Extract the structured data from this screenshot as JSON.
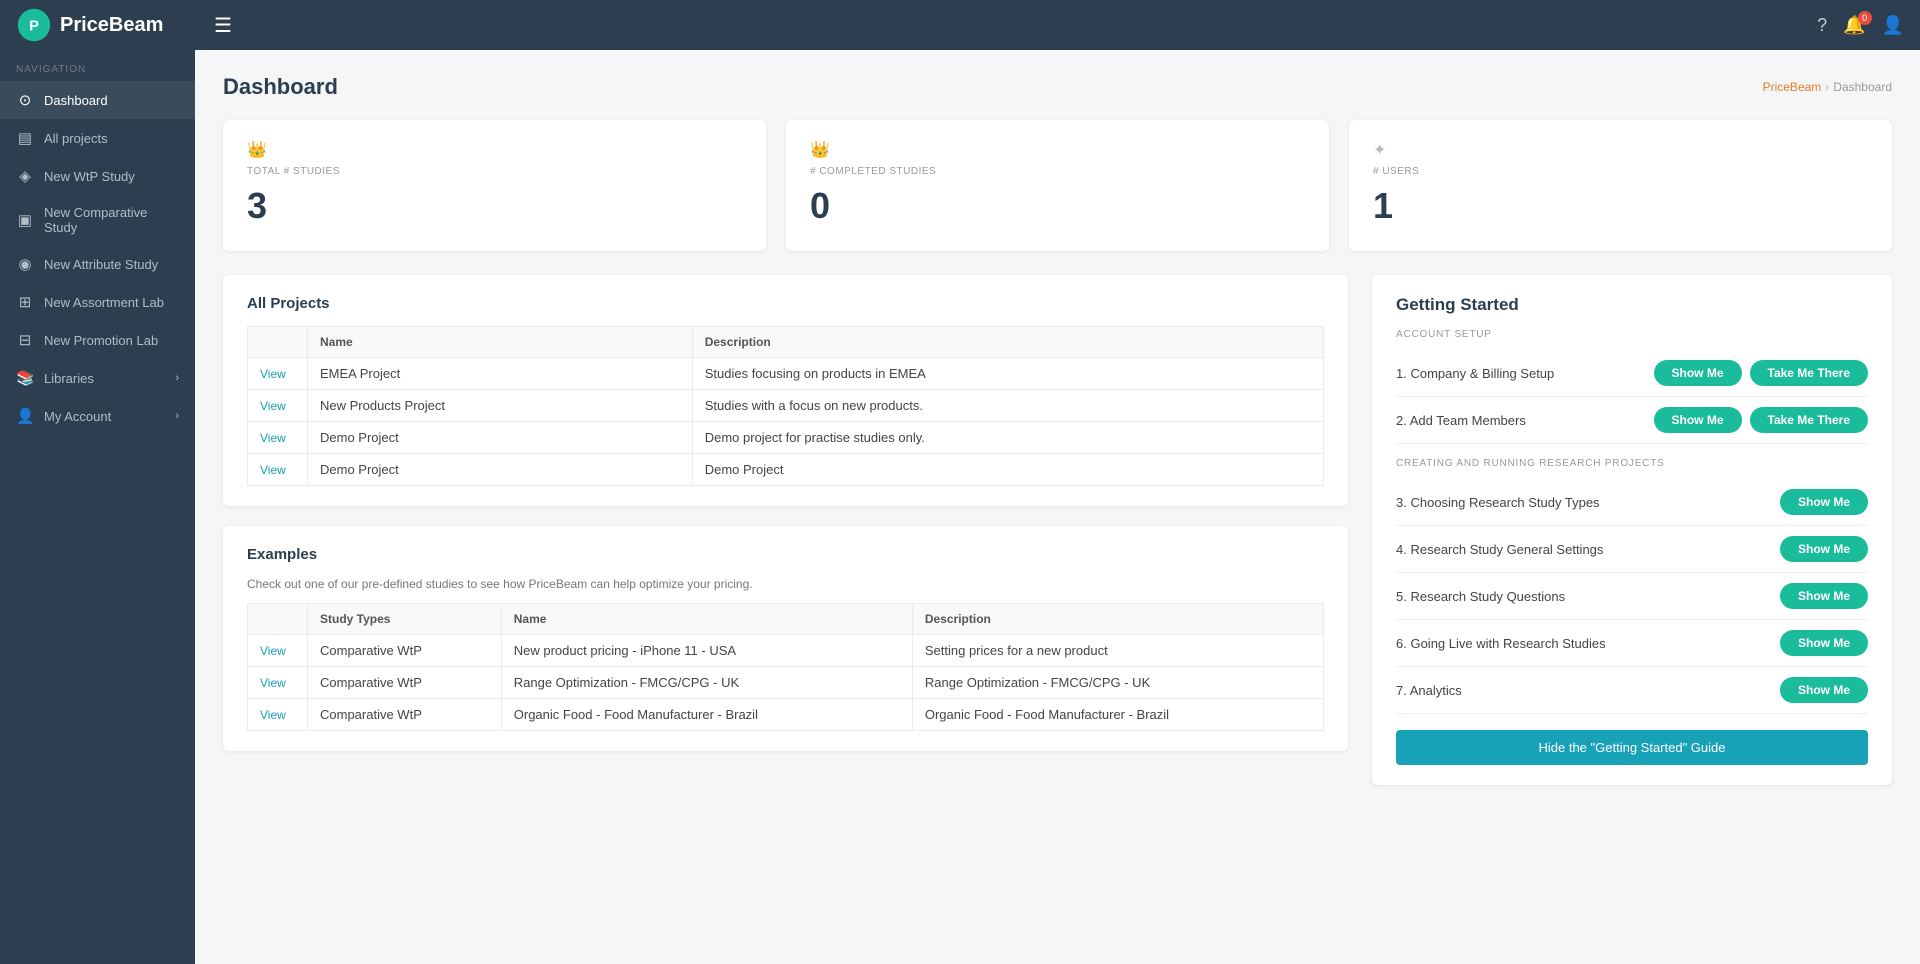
{
  "topbar": {
    "logo_text": "PriceBeam",
    "menu_icon": "☰",
    "notification_count": "0",
    "icons": {
      "help": "?",
      "bell": "🔔",
      "user": "👤"
    }
  },
  "sidebar": {
    "nav_label": "NAVIGATION",
    "items": [
      {
        "id": "dashboard",
        "label": "Dashboard",
        "icon": "⊙",
        "active": true
      },
      {
        "id": "all-projects",
        "label": "All projects",
        "icon": "▤",
        "active": false
      },
      {
        "id": "new-wtp-study",
        "label": "New WtP Study",
        "icon": "◈",
        "active": false
      },
      {
        "id": "new-comparative-study",
        "label": "New Comparative Study",
        "icon": "▣",
        "active": false
      },
      {
        "id": "new-attribute-study",
        "label": "New Attribute Study",
        "icon": "◉",
        "active": false
      },
      {
        "id": "new-assortment-lab",
        "label": "New Assortment Lab",
        "icon": "⊞",
        "active": false
      },
      {
        "id": "new-promotion-lab",
        "label": "New Promotion Lab",
        "icon": "⊟",
        "active": false
      },
      {
        "id": "libraries",
        "label": "Libraries",
        "icon": "📚",
        "has_arrow": true,
        "active": false
      },
      {
        "id": "my-account",
        "label": "My Account",
        "icon": "👤",
        "has_arrow": true,
        "active": false
      }
    ]
  },
  "page": {
    "title": "Dashboard",
    "breadcrumb_home": "PriceBeam",
    "breadcrumb_current": "Dashboard"
  },
  "stats": [
    {
      "icon": "👑",
      "label": "TOTAL # STUDIES",
      "value": "3"
    },
    {
      "icon": "👑",
      "label": "# COMPLETED STUDIES",
      "value": "0"
    },
    {
      "icon": "✦",
      "label": "# USERS",
      "value": "1"
    }
  ],
  "all_projects": {
    "section_title": "All Projects",
    "columns": [
      "",
      "Name",
      "Description"
    ],
    "rows": [
      {
        "view": "View",
        "name": "EMEA Project",
        "description": "Studies focusing on products in EMEA"
      },
      {
        "view": "View",
        "name": "New Products Project",
        "description": "Studies with a focus on new products."
      },
      {
        "view": "View",
        "name": "Demo Project",
        "description": "Demo project for practise studies only."
      },
      {
        "view": "View",
        "name": "Demo Project",
        "description": "Demo Project"
      }
    ]
  },
  "examples": {
    "section_title": "Examples",
    "note": "Check out one of our pre-defined studies to see how PriceBeam can help optimize your pricing.",
    "columns": [
      "",
      "Study Types",
      "Name",
      "Description"
    ],
    "rows": [
      {
        "view": "View",
        "study_type": "Comparative WtP",
        "name": "New product pricing - iPhone 11 - USA",
        "description": "Setting prices for a new product"
      },
      {
        "view": "View",
        "study_type": "Comparative WtP",
        "name": "Range Optimization - FMCG/CPG - UK",
        "description": "Range Optimization - FMCG/CPG - UK"
      },
      {
        "view": "View",
        "study_type": "Comparative WtP",
        "name": "Organic Food - Food Manufacturer - Brazil",
        "description": "Organic Food - Food Manufacturer - Brazil"
      }
    ]
  },
  "getting_started": {
    "title": "Getting Started",
    "account_setup_label": "ACCOUNT SETUP",
    "research_label": "CREATING AND RUNNING RESEARCH PROJECTS",
    "steps": [
      {
        "num": "1",
        "label": "Company & Billing Setup",
        "show": "Show Me",
        "take": "Take Me There",
        "section": "account"
      },
      {
        "num": "2",
        "label": "Add Team Members",
        "show": "Show Me",
        "take": "Take Me There",
        "section": "account"
      },
      {
        "num": "3",
        "label": "Choosing Research Study Types",
        "show": "Show Me",
        "section": "research"
      },
      {
        "num": "4",
        "label": "Research Study General Settings",
        "show": "Show Me",
        "section": "research"
      },
      {
        "num": "5",
        "label": "Research Study Questions",
        "show": "Show Me",
        "section": "research"
      },
      {
        "num": "6",
        "label": "Going Live with Research Studies",
        "show": "Show Me",
        "section": "research"
      },
      {
        "num": "7",
        "label": "Analytics",
        "show": "Show Me",
        "section": "research"
      }
    ],
    "hide_btn_label": "Hide the \"Getting Started\" Guide"
  }
}
